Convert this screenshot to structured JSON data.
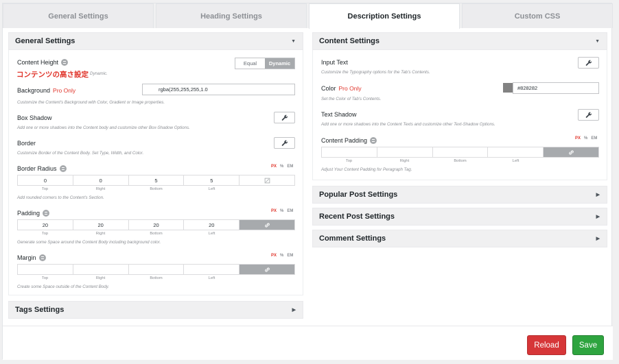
{
  "tabs": [
    "General Settings",
    "Heading Settings",
    "Description Settings",
    "Custom CSS"
  ],
  "left": {
    "general": {
      "title": "General Settings",
      "content_height": {
        "label": "Content Height",
        "annotation": "コンテンツの高さ設定",
        "desc_tail": "Dynamic.",
        "options": [
          "Equal",
          "Dynamic"
        ]
      },
      "background": {
        "label": "Background",
        "pro": "Pro Only",
        "value": "rgba(255,255,255,1.0",
        "desc": "Customize the Content's Background with Color, Gradient or Image properties."
      },
      "box_shadow": {
        "label": "Box Shadow",
        "desc": "Add one or more shadows into the Content body and customize other Box-Shadow Options."
      },
      "border": {
        "label": "Border",
        "desc": "Customize Border of the Content Body. Set Type, Width, and Color."
      },
      "border_radius": {
        "label": "Border Radius",
        "values": [
          "0",
          "0",
          "5",
          "5"
        ],
        "sides": [
          "Top",
          "Right",
          "Bottom",
          "Left"
        ],
        "desc": "Add rounded corners to the Content's Section."
      },
      "padding": {
        "label": "Padding",
        "values": [
          "20",
          "20",
          "20",
          "20"
        ],
        "sides": [
          "Top",
          "Right",
          "Bottom",
          "Left"
        ],
        "desc": "Generate some Space around the Content Body including background color."
      },
      "margin": {
        "label": "Margin",
        "values": [
          "",
          "",
          "",
          ""
        ],
        "sides": [
          "Top",
          "Right",
          "Bottom",
          "Left"
        ],
        "desc": "Create some Space outside of the Content Body."
      }
    },
    "tags": {
      "title": "Tags Settings"
    }
  },
  "units": [
    "PX",
    "%",
    "EM"
  ],
  "right": {
    "content": {
      "title": "Content Settings",
      "input_text": {
        "label": "Input Text",
        "desc": "Customize the Typography options for the Tab's Contents."
      },
      "color": {
        "label": "Color",
        "pro": "Pro Only",
        "value": "#828282",
        "swatch": "#828282",
        "desc": "Set the Color of Tab's Contents."
      },
      "text_shadow": {
        "label": "Text Shadow",
        "desc": "Add one or more shadows into the Content Texts and customize other Text-Shadow Options."
      },
      "content_padding": {
        "label": "Content Padding",
        "values": [
          "",
          "",
          "",
          ""
        ],
        "sides": [
          "Top",
          "Right",
          "Bottom",
          "Left"
        ],
        "desc": "Adjust Your Content Padding for Peragraph Tag."
      }
    },
    "popular": {
      "title": "Popular Post Settings"
    },
    "recent": {
      "title": "Recent Post Settings"
    },
    "comment": {
      "title": "Comment Settings"
    }
  },
  "footer": {
    "reload": "Reload",
    "save": "Save"
  },
  "colors": {
    "accent_red": "#d63638",
    "save_green": "#2ea43f",
    "pro_red": "#e0342a"
  }
}
